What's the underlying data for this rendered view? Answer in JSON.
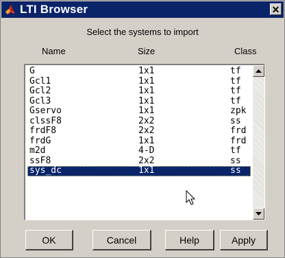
{
  "window": {
    "title": "LTI Browser",
    "icons": {
      "app": "matlab-logo-icon",
      "close": "close-icon",
      "close_glyph": "✕"
    }
  },
  "prompt": "Select the systems to import",
  "columns": {
    "name": "Name",
    "size": "Size",
    "class": "Class"
  },
  "systems": [
    {
      "name": "G",
      "size": "1x1",
      "class": "tf"
    },
    {
      "name": "Gcl1",
      "size": "1x1",
      "class": "tf"
    },
    {
      "name": "Gcl2",
      "size": "1x1",
      "class": "tf"
    },
    {
      "name": "Gcl3",
      "size": "1x1",
      "class": "tf"
    },
    {
      "name": "Gservo",
      "size": "1x1",
      "class": "zpk"
    },
    {
      "name": "clssF8",
      "size": "2x2",
      "class": "ss"
    },
    {
      "name": "frdF8",
      "size": "2x2",
      "class": "frd"
    },
    {
      "name": "frdG",
      "size": "1x1",
      "class": "frd"
    },
    {
      "name": "m2d",
      "size": "4-D",
      "class": "tf"
    },
    {
      "name": "ssF8",
      "size": "2x2",
      "class": "ss"
    },
    {
      "name": "sys_dc",
      "size": "1x1",
      "class": "ss",
      "selected": true
    }
  ],
  "buttons": {
    "ok": "OK",
    "cancel": "Cancel",
    "help": "Help",
    "apply": "Apply"
  },
  "colors": {
    "titlebar": "#0a246a",
    "selection": "#0a246a",
    "dialog": "#d4d0c8"
  }
}
